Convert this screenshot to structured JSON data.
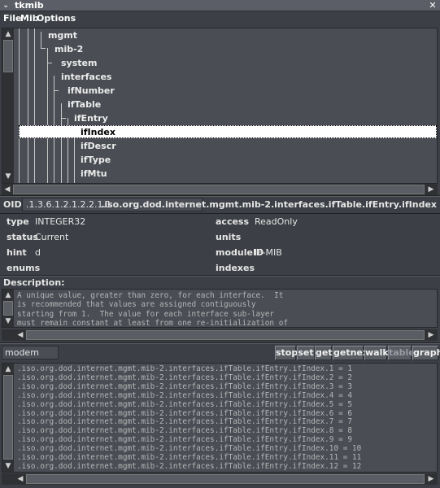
{
  "window": {
    "title": "tkmib"
  },
  "menubar": {
    "items": [
      "File",
      "Mib",
      "Options"
    ]
  },
  "tree": {
    "nodes": [
      {
        "label": "mgmt"
      },
      {
        "label": "mib-2"
      },
      {
        "label": "system"
      },
      {
        "label": "interfaces"
      },
      {
        "label": "ifNumber"
      },
      {
        "label": "ifTable"
      },
      {
        "label": "ifEntry"
      },
      {
        "label": "ifIndex",
        "selected": true
      },
      {
        "label": "ifDescr"
      },
      {
        "label": "ifType"
      },
      {
        "label": "ifMtu"
      }
    ]
  },
  "oid": {
    "label": "OID:",
    "value": ".1.3.6.1.2.1.2.2.1.1",
    "path": ".iso.org.dod.internet.mgmt.mib-2.interfaces.ifTable.ifEntry.ifIndex"
  },
  "props": {
    "type_label": "type",
    "type_value": "INTEGER32",
    "access_label": "access",
    "access_value": "ReadOnly",
    "status_label": "status",
    "status_value": "Current",
    "units_label": "units",
    "units_value": "",
    "hint_label": "hint",
    "hint_value": "d",
    "moduleid_label": "moduleID",
    "moduleid_value": "IF-MIB",
    "enums_label": "enums",
    "indexes_label": "indexes"
  },
  "description": {
    "label": "Description:",
    "lines": [
      "A unique value, greater than zero, for each interface.  It",
      "is recommended that values are assigned contiguously",
      "starting from 1.  The value for each interface sub-layer",
      "must remain constant at least from one re-initialization of"
    ]
  },
  "command": {
    "host": "modem",
    "buttons": [
      {
        "label": "stop",
        "enabled": true
      },
      {
        "label": "set",
        "enabled": true
      },
      {
        "label": "get",
        "enabled": true
      },
      {
        "label": "getnext",
        "enabled": true
      },
      {
        "label": "walk",
        "enabled": true
      },
      {
        "label": "table",
        "enabled": false
      },
      {
        "label": "graph",
        "enabled": true
      }
    ]
  },
  "output": {
    "lines": [
      ".iso.org.dod.internet.mgmt.mib-2.interfaces.ifTable.ifEntry.ifIndex.1 = 1",
      ".iso.org.dod.internet.mgmt.mib-2.interfaces.ifTable.ifEntry.ifIndex.2 = 2",
      ".iso.org.dod.internet.mgmt.mib-2.interfaces.ifTable.ifEntry.ifIndex.3 = 3",
      ".iso.org.dod.internet.mgmt.mib-2.interfaces.ifTable.ifEntry.ifIndex.4 = 4",
      ".iso.org.dod.internet.mgmt.mib-2.interfaces.ifTable.ifEntry.ifIndex.5 = 5",
      ".iso.org.dod.internet.mgmt.mib-2.interfaces.ifTable.ifEntry.ifIndex.6 = 6",
      ".iso.org.dod.internet.mgmt.mib-2.interfaces.ifTable.ifEntry.ifIndex.7 = 7",
      ".iso.org.dod.internet.mgmt.mib-2.interfaces.ifTable.ifEntry.ifIndex.8 = 8",
      ".iso.org.dod.internet.mgmt.mib-2.interfaces.ifTable.ifEntry.ifIndex.9 = 9",
      ".iso.org.dod.internet.mgmt.mib-2.interfaces.ifTable.ifEntry.ifIndex.10 = 10",
      ".iso.org.dod.internet.mgmt.mib-2.interfaces.ifTable.ifEntry.ifIndex.11 = 11",
      ".iso.org.dod.internet.mgmt.mib-2.interfaces.ifTable.ifEntry.ifIndex.12 = 12"
    ]
  }
}
